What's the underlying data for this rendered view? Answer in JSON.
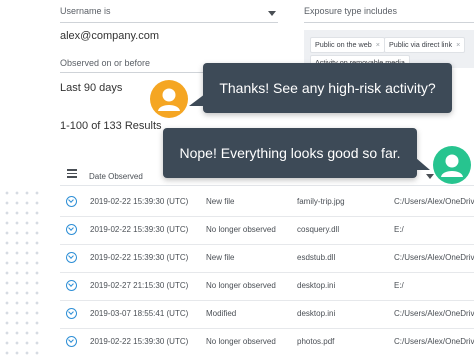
{
  "filters": {
    "username_label": "Username is",
    "username_value": "alex@company.com",
    "observed_label": "Observed on or before",
    "observed_value": "Last 90 days",
    "exposure_label": "Exposure type includes",
    "exposure_chips": [
      "Public on the web",
      "Public via direct link",
      "Activity on removable media"
    ]
  },
  "chat": {
    "message_1": "Thanks! See any high-risk activity?",
    "message_2": "Nope! Everything looks good so far."
  },
  "results": {
    "summary": "1-100 of 133 Results"
  },
  "table": {
    "date_header": "Date Observed",
    "rows": [
      {
        "date": "2019-02-22 15:39:30 (UTC)",
        "event": "New file",
        "file": "family-trip.jpg",
        "path": "C:/Users/Alex/OneDrive"
      },
      {
        "date": "2019-02-22 15:39:30 (UTC)",
        "event": "No longer observed",
        "file": "cosquery.dll",
        "path": "E:/"
      },
      {
        "date": "2019-02-22 15:39:30 (UTC)",
        "event": "New file",
        "file": "esdstub.dll",
        "path": "C:/Users/Alex/OneDrive"
      },
      {
        "date": "2019-02-27 21:15:30 (UTC)",
        "event": "No longer observed",
        "file": "desktop.ini",
        "path": "E:/"
      },
      {
        "date": "2019-03-07 18:55:41 (UTC)",
        "event": "Modified",
        "file": "desktop.ini",
        "path": "C:/Users/Alex/OneDrive"
      },
      {
        "date": "2019-02-22 15:39:30 (UTC)",
        "event": "No longer observed",
        "file": "photos.pdf",
        "path": "C:/Users/Alex/OneDrive"
      }
    ]
  },
  "colors": {
    "accent": "#2e8fd6",
    "bubble": "#3d4a57",
    "avatar_orange": "#f5a623",
    "avatar_green": "#27c48f"
  }
}
